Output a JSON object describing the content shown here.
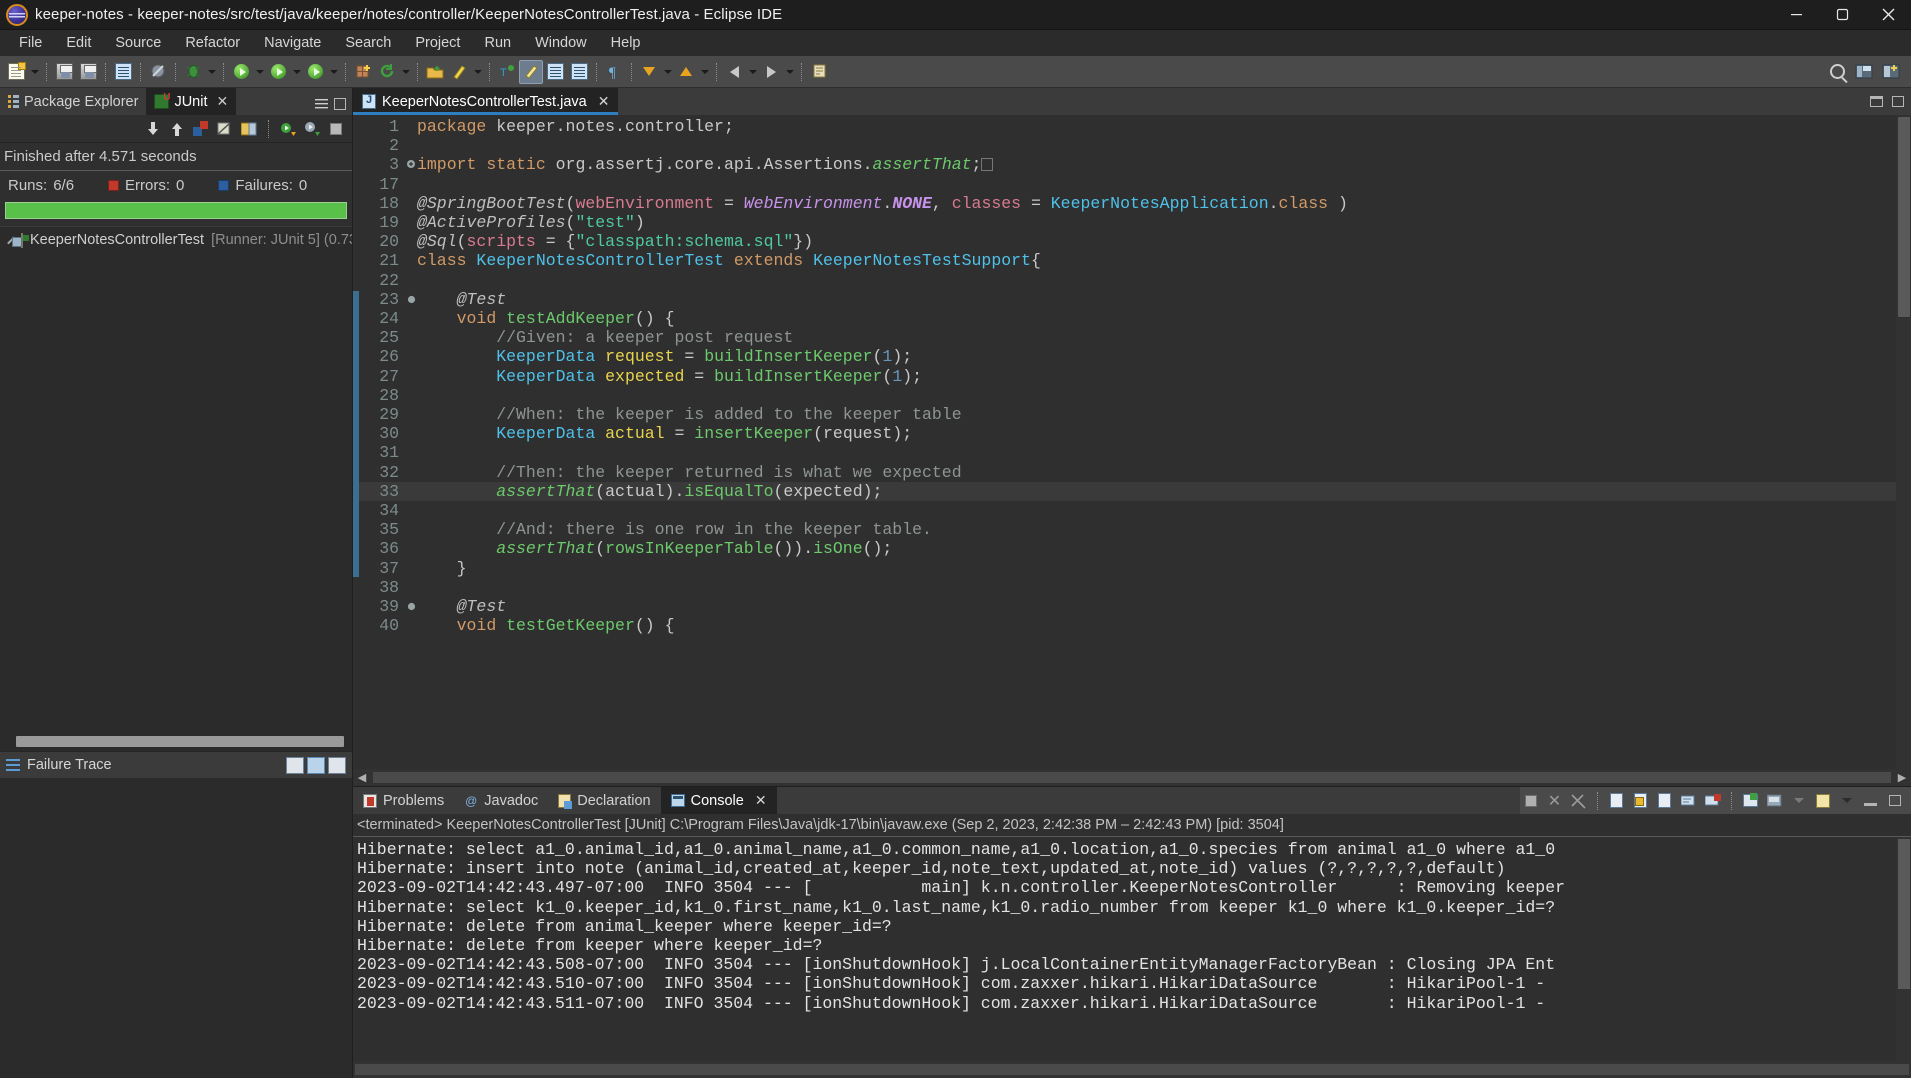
{
  "window": {
    "title": "keeper-notes - keeper-notes/src/test/java/keeper/notes/controller/KeeperNotesControllerTest.java - Eclipse IDE",
    "minimize_label": "Minimize",
    "maximize_label": "Maximize",
    "close_label": "Close"
  },
  "menubar": {
    "items": [
      {
        "label": "File"
      },
      {
        "label": "Edit"
      },
      {
        "label": "Source"
      },
      {
        "label": "Refactor"
      },
      {
        "label": "Navigate"
      },
      {
        "label": "Search"
      },
      {
        "label": "Project"
      },
      {
        "label": "Run"
      },
      {
        "label": "Window"
      },
      {
        "label": "Help"
      }
    ]
  },
  "toolbar": {
    "icons": [
      "new-wizard-icon",
      "save-icon",
      "save-all-icon",
      "new-java-doc-icon",
      "skip-breakpoints-icon",
      "debug-icon",
      "run-icon",
      "run-last-icon",
      "coverage-icon",
      "new-package-icon",
      "refresh-icon",
      "open-type-icon",
      "external-tools-icon",
      "search-icon",
      "toggle-mark-occurrences-icon",
      "next-annotation-icon",
      "previous-annotation-icon",
      "back-icon",
      "forward-icon",
      "pin-editor-icon"
    ],
    "search_icon": "search-icon",
    "perspective_java_icon": "java-perspective-icon",
    "perspective_debug_icon": "debug-perspective-icon"
  },
  "left_panel": {
    "tabs": [
      {
        "label": "Package Explorer",
        "icon": "package-explorer-icon",
        "active": false,
        "closable": false
      },
      {
        "label": "JUnit",
        "icon": "junit-icon",
        "active": true,
        "closable": true
      }
    ],
    "junit_toolbar_icons": [
      "next-failure-icon",
      "previous-failure-icon",
      "show-failures-only-icon",
      "show-ignored-icon",
      "scroll-lock-icon",
      "rerun-test-icon",
      "rerun-failed-icon",
      "stop-icon"
    ],
    "status": "Finished after 4.571 seconds",
    "counters": {
      "runs_label": "Runs:",
      "runs_value": "6/6",
      "errors_label": "Errors:",
      "errors_value": "0",
      "failures_label": "Failures:",
      "failures_value": "0"
    },
    "progress": {
      "percent": 100,
      "color": "#59c04a"
    },
    "tree": [
      {
        "expander": "collapsed",
        "icon": "test-class-icon",
        "name": "KeeperNotesControllerTest",
        "detail": "[Runner: JUnit 5] (0.73"
      }
    ],
    "failure_trace": {
      "title": "Failure Trace",
      "icon": "failure-trace-icon",
      "tool_icons": [
        "copy-trace-icon",
        "filter-stack-trace-icon",
        "compare-result-icon"
      ],
      "content": ""
    }
  },
  "editor": {
    "tabs": [
      {
        "label": "KeeperNotesControllerTest.java",
        "icon": "java-file-icon",
        "active": true
      }
    ],
    "tab_tools": [
      "minimize-editor-icon",
      "maximize-editor-icon"
    ],
    "lines": [
      {
        "n": "1",
        "mark": "",
        "html": "<span class=\"kw\">package</span> <span class=\"plain\">keeper.notes.controller;</span>"
      },
      {
        "n": "2",
        "mark": "",
        "html": ""
      },
      {
        "n": "3",
        "mark": "+",
        "html": "<span class=\"kw\">import</span> <span class=\"kw\">static</span> <span class=\"plain\">org.assertj.core.api.Assertions.</span><span class=\"greeni\">assertThat</span><span class=\"plain\">;</span><span class=\"emptybox\"></span>"
      },
      {
        "n": "17",
        "mark": "",
        "html": ""
      },
      {
        "n": "18",
        "mark": "",
        "html": "<span class=\"ann\">@SpringBootTest</span><span class=\"plain\">(</span><span class=\"pink\">webEnvironment</span> <span class=\"plain\">=</span> <span class=\"purple\">WebEnvironment</span><span class=\"plain\">.</span><span class=\"purple boldi\">NONE</span><span class=\"plain\">,</span> <span class=\"pink\">classes</span> <span class=\"plain\">=</span> <span class=\"type\">KeeperNotesApplication</span><span class=\"plain\">.</span><span class=\"kw\">class</span> <span class=\"plain\">)</span>"
      },
      {
        "n": "19",
        "mark": "",
        "html": "<span class=\"ann\">@ActiveProfiles</span><span class=\"plain\">(</span><span class=\"str\">\"test\"</span><span class=\"plain\">)</span>"
      },
      {
        "n": "20",
        "mark": "",
        "html": "<span class=\"ann\">@Sql</span><span class=\"plain\">(</span><span class=\"pink\">scripts</span> <span class=\"plain\">= {</span><span class=\"str\">\"classpath:schema.sql\"</span><span class=\"plain\">})</span>"
      },
      {
        "n": "21",
        "mark": "",
        "html": "<span class=\"kw\">class</span> <span class=\"type\">KeeperNotesControllerTest</span> <span class=\"kw\">extends</span> <span class=\"type\">KeeperNotesTestSupport</span><span class=\"plain\">{</span>"
      },
      {
        "n": "22",
        "mark": "",
        "html": ""
      },
      {
        "n": "23",
        "mark": "*",
        "html": "    <span class=\"ann\">@Test</span>"
      },
      {
        "n": "24",
        "mark": "",
        "html": "    <span class=\"kw\">void</span> <span class=\"meth\">testAddKeeper</span><span class=\"plain\">() {</span>"
      },
      {
        "n": "25",
        "mark": "",
        "html": "        <span class=\"cmt\">//Given: a keeper post request</span>"
      },
      {
        "n": "26",
        "mark": "",
        "html": "        <span class=\"type\">KeeperData</span> <span class=\"fld\">request</span> <span class=\"plain\">=</span> <span class=\"meth\">buildInsertKeeper</span><span class=\"plain\">(</span><span class=\"num\">1</span><span class=\"plain\">);</span>"
      },
      {
        "n": "27",
        "mark": "",
        "html": "        <span class=\"type\">KeeperData</span> <span class=\"fld\">expected</span> <span class=\"plain\">=</span> <span class=\"meth\">buildInsertKeeper</span><span class=\"plain\">(</span><span class=\"num\">1</span><span class=\"plain\">);</span>"
      },
      {
        "n": "28",
        "mark": "",
        "html": ""
      },
      {
        "n": "29",
        "mark": "",
        "html": "        <span class=\"cmt\">//When: the keeper is added to the keeper table</span>"
      },
      {
        "n": "30",
        "mark": "",
        "html": "        <span class=\"type\">KeeperData</span> <span class=\"fld\">actual</span> <span class=\"plain\">=</span> <span class=\"meth\">insertKeeper</span><span class=\"plain\">(request);</span>"
      },
      {
        "n": "31",
        "mark": "",
        "html": ""
      },
      {
        "n": "32",
        "mark": "",
        "html": "        <span class=\"cmt\">//Then: the keeper returned is what we expected</span>"
      },
      {
        "n": "33",
        "mark": "",
        "html": "        <span class=\"greeni\">assertThat</span><span class=\"plain\">(actual).</span><span class=\"meth\">isEqualTo</span><span class=\"plain\">(expected);</span>",
        "highlight": true
      },
      {
        "n": "34",
        "mark": "",
        "html": ""
      },
      {
        "n": "35",
        "mark": "",
        "html": "        <span class=\"cmt\">//And: there is one row in the keeper table.</span>"
      },
      {
        "n": "36",
        "mark": "",
        "html": "        <span class=\"greeni\">assertThat</span><span class=\"plain\">(</span><span class=\"meth\">rowsInKeeperTable</span><span class=\"plain\">()).</span><span class=\"meth\">isOne</span><span class=\"plain\">();</span>"
      },
      {
        "n": "37",
        "mark": "",
        "html": "    <span class=\"plain\">}</span>"
      },
      {
        "n": "38",
        "mark": "",
        "html": ""
      },
      {
        "n": "39",
        "mark": "*",
        "html": "    <span class=\"ann\">@Test</span>"
      },
      {
        "n": "40",
        "mark": "",
        "html": "    <span class=\"kw\">void</span> <span class=\"meth\">testGetKeeper</span><span class=\"plain\">() {</span>"
      }
    ]
  },
  "console": {
    "tabs": [
      {
        "label": "Problems",
        "icon": "problems-icon",
        "active": false,
        "closable": false
      },
      {
        "label": "Javadoc",
        "icon": "javadoc-icon",
        "active": false,
        "closable": false
      },
      {
        "label": "Declaration",
        "icon": "declaration-icon",
        "active": false,
        "closable": false
      },
      {
        "label": "Console",
        "icon": "console-icon",
        "active": true,
        "closable": true
      }
    ],
    "tool_icons": [
      "terminate-icon",
      "remove-launch-icon",
      "remove-all-terminated-icon",
      "clear-console-icon",
      "scroll-lock-icon",
      "word-wrap-icon",
      "show-console-on-output-icon",
      "pin-console-icon",
      "display-selected-console-icon",
      "open-console-icon",
      "minimize-icon",
      "maximize-icon"
    ],
    "meta": "<terminated> KeeperNotesControllerTest [JUnit] C:\\Program Files\\Java\\jdk-17\\bin\\javaw.exe  (Sep 2, 2023, 2:42:38 PM – 2:42:43 PM) [pid: 3504]",
    "output": "Hibernate: select a1_0.animal_id,a1_0.animal_name,a1_0.common_name,a1_0.location,a1_0.species from animal a1_0 where a1_0\nHibernate: insert into note (animal_id,created_at,keeper_id,note_text,updated_at,note_id) values (?,?,?,?,?,default)\n2023-09-02T14:42:43.497-07:00  INFO 3504 --- [           main] k.n.controller.KeeperNotesController      : Removing keeper\nHibernate: select k1_0.keeper_id,k1_0.first_name,k1_0.last_name,k1_0.radio_number from keeper k1_0 where k1_0.keeper_id=?\nHibernate: delete from animal_keeper where keeper_id=?\nHibernate: delete from keeper where keeper_id=?\n2023-09-02T14:42:43.508-07:00  INFO 3504 --- [ionShutdownHook] j.LocalContainerEntityManagerFactoryBean : Closing JPA Ent\n2023-09-02T14:42:43.510-07:00  INFO 3504 --- [ionShutdownHook] com.zaxxer.hikari.HikariDataSource       : HikariPool-1 - \n2023-09-02T14:42:43.511-07:00  INFO 3504 --- [ionShutdownHook] com.zaxxer.hikari.HikariDataSource       : HikariPool-1 - "
  },
  "colors": {
    "accent": "#2d7fc1",
    "success": "#59c04a",
    "error": "#c0392b",
    "failure": "#2c5f9e",
    "background": "#2f2f2f",
    "panel": "#3b3b3b",
    "editor_bg": "#2f2f2f"
  }
}
